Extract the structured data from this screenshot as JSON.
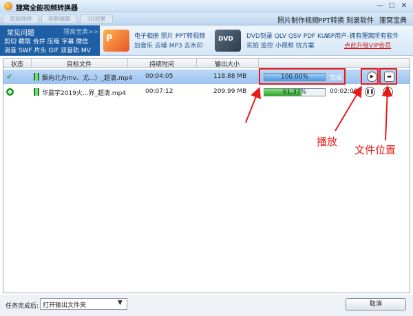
{
  "window": {
    "title": "狸窝全能视频转换器",
    "minimize_glyph": "—",
    "maximize_glyph": "□",
    "close_glyph": "✕"
  },
  "toolbar": {
    "add_video": "添加视频",
    "video_edit": "视频编辑",
    "effect_3d": "3D效果",
    "photo_video": "照片制作视频",
    "ppt_convert": "PPT转换",
    "burn_software": "刻录软件",
    "treasure": "狸窝宝典"
  },
  "banner": {
    "common_title": "常见问题",
    "treasure_link": "狸窝宝典>>",
    "features_line1": "剪切 截取 合并 压缩 字幕 微信",
    "features_line2": "消音 SWF 片头 GIF 双音轨 MV",
    "ppt_logo_text": "P",
    "dvd_logo_text": "DVD",
    "photo_line1": "电子相册 照片 PPT转视频",
    "photo_line2": "加音乐 去噪 MP3 去水印",
    "dvd_line1": "DVD刻录 QLV QSV PDF KUX",
    "dvd_line2": "实拍 监控 小视频 抗方案",
    "vip_text": "VIP用户-拥有狸窝所有软件",
    "vip_upgrade": "点此升级VIP会员"
  },
  "table": {
    "headers": [
      "状态",
      "目标文件",
      "持续时间",
      "输出大小"
    ],
    "rows": [
      {
        "file": "飘向北方mv、尤...）_超清.mp4",
        "duration": "00:04:05",
        "size": "118.88 MB",
        "progress_value": 100,
        "progress_text": "100.00%",
        "status_text": "完成",
        "eta": "",
        "status_glyph": "✔",
        "action_glyph": "▶",
        "folder_glyph": "▬"
      },
      {
        "file": "华晨宇2019火...界_超清.mp4",
        "duration": "00:07:12",
        "size": "209.99 MB",
        "progress_value": 61.37,
        "progress_text": "61.37%",
        "status_text": "",
        "eta": "00:02:00",
        "action_glyph": "❚❚",
        "next_glyph": "›"
      }
    ]
  },
  "annotations": {
    "play_label": "播放",
    "folder_label": "文件位置",
    "color": "#e81b1b"
  },
  "bottom": {
    "after_label": "任务完成后:",
    "after_value": "打开输出文件夹",
    "dropdown_glyph": "▼",
    "cancel": "取消"
  }
}
